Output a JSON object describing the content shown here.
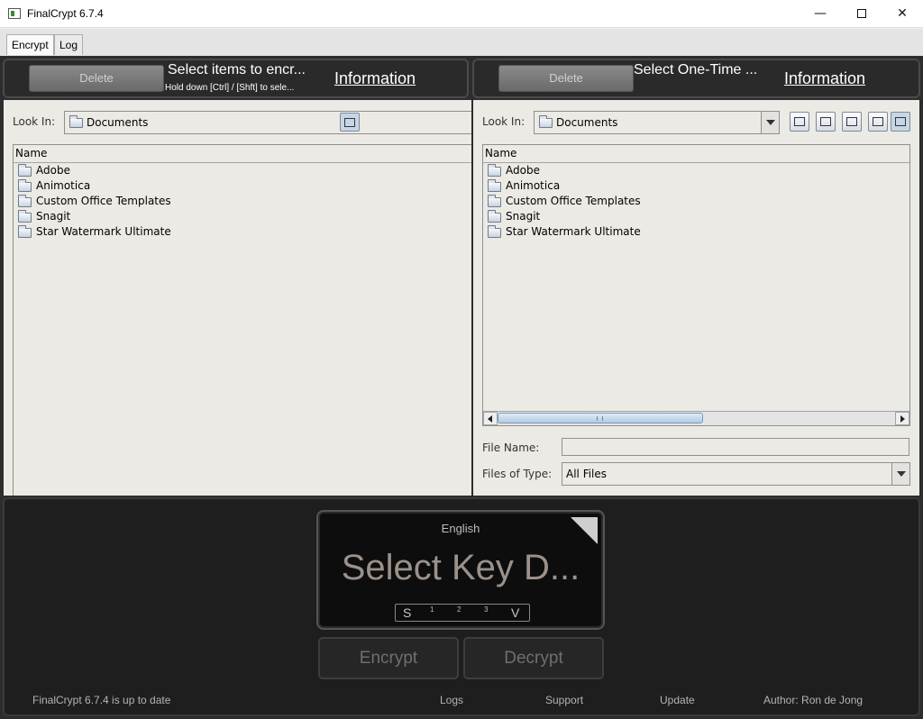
{
  "window": {
    "title": "FinalCrypt 6.7.4",
    "minimize_glyph": "—",
    "close_glyph": "✕"
  },
  "tabs": [
    {
      "label": "Encrypt",
      "active": true
    },
    {
      "label": "Log",
      "active": false
    }
  ],
  "left_header": {
    "delete_label": "Delete",
    "title": "Select items to encr...",
    "subtitle": "Hold down [Ctrl] / [Shft] to sele...",
    "info_label": "Information"
  },
  "right_header": {
    "delete_label": "Delete",
    "title": "Select One-Time ...",
    "info_label": "Information"
  },
  "left_chooser": {
    "look_in_label": "Look In:",
    "look_in_value": "Documents",
    "column_name": "Name",
    "items": [
      "Adobe",
      "Animotica",
      "Custom Office Templates",
      "Snagit",
      "Star Watermark Ultimate"
    ]
  },
  "right_chooser": {
    "look_in_label": "Look In:",
    "look_in_value": "Documents",
    "column_name": "Name",
    "items": [
      "Adobe",
      "Animotica",
      "Custom Office Templates",
      "Snagit",
      "Star Watermark Ultimate"
    ],
    "file_name_label": "File Name:",
    "file_name_value": "",
    "files_of_type_label": "Files of Type:",
    "files_of_type_value": "All Files"
  },
  "key_panel": {
    "language": "English",
    "title": "Select Key D...",
    "meter_start": "S",
    "meter_end": "V",
    "meter_ticks": [
      "1",
      "2",
      "3"
    ]
  },
  "actions": {
    "encrypt_label": "Encrypt",
    "decrypt_label": "Decrypt"
  },
  "footer": {
    "status": "FinalCrypt 6.7.4 is up to date",
    "logs": "Logs",
    "support": "Support",
    "update": "Update",
    "author": "Author: Ron de Jong"
  },
  "colors": {
    "dark_background": "#2d2d2d",
    "chooser_background": "#eceae5",
    "accent_scroll": "#b4cbe2"
  }
}
